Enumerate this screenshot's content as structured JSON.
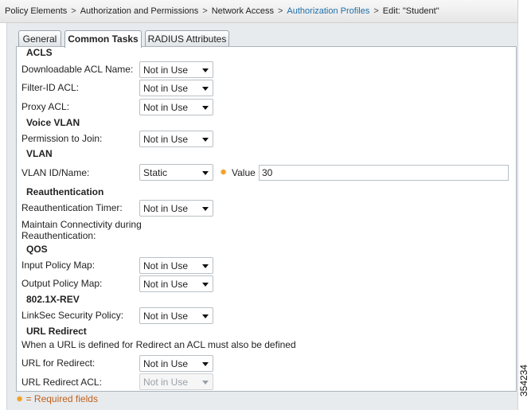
{
  "breadcrumb": {
    "items": [
      "Policy Elements",
      "Authorization and Permissions",
      "Network Access",
      "Authorization Profiles",
      "Edit: \"Student\""
    ],
    "separator": ">"
  },
  "tabs": [
    {
      "label": "General",
      "active": false
    },
    {
      "label": "Common Tasks",
      "active": true
    },
    {
      "label": "RADIUS Attributes",
      "active": false
    }
  ],
  "sections": {
    "acls": "ACLS",
    "voice_vlan": "Voice VLAN",
    "vlan": "VLAN",
    "reauth": "Reauthentication",
    "qos": "QOS",
    "dot1x": "802.1X-REV",
    "url_redirect": "URL Redirect"
  },
  "fields": {
    "downloadable_acl": {
      "label": "Downloadable ACL Name:",
      "value": "Not in Use"
    },
    "filter_id_acl": {
      "label": "Filter-ID ACL:",
      "value": "Not in Use"
    },
    "proxy_acl": {
      "label": "Proxy ACL:",
      "value": "Not in Use"
    },
    "permission_to_join": {
      "label": "Permission to Join:",
      "value": "Not in Use"
    },
    "vlan_id": {
      "label": "VLAN ID/Name:",
      "value": "Static",
      "value_label": "Value",
      "value_text": "30"
    },
    "reauth_timer": {
      "label": "Reauthentication Timer:",
      "value": "Not in Use"
    },
    "maintain_connectivity": {
      "label_line1": "Maintain Connectivity during",
      "label_line2": "Reauthentication:"
    },
    "input_policy_map": {
      "label": "Input Policy Map:",
      "value": "Not in Use"
    },
    "output_policy_map": {
      "label": "Output Policy Map:",
      "value": "Not in Use"
    },
    "linksec_policy": {
      "label": "LinkSec Security Policy:",
      "value": "Not in Use"
    },
    "url_redirect_note": "When a URL is defined for Redirect an ACL must also be defined",
    "url_for_redirect": {
      "label": "URL for Redirect:",
      "value": "Not in Use"
    },
    "url_redirect_acl": {
      "label": "URL Redirect ACL:",
      "value": "Not in Use",
      "disabled": true
    }
  },
  "footer": {
    "required_text": "= Required fields"
  },
  "figure_id": "354234",
  "colors": {
    "accent_link": "#1f6fa8",
    "required": "#f0a020",
    "required_text": "#c0601c"
  },
  "icons": {
    "required_marker": "gear-icon",
    "dropdown": "chevron-down-icon"
  }
}
